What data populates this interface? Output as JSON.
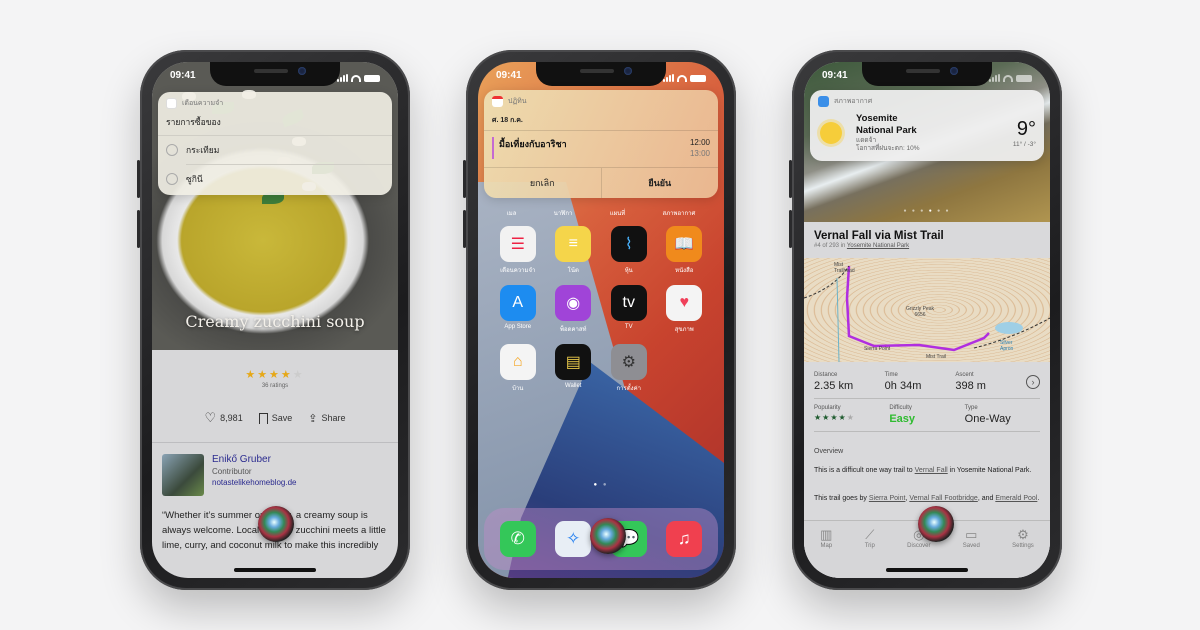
{
  "status_time": "09:41",
  "phone1": {
    "widget": {
      "app_name": "เตือนความจำ",
      "list_title": "รายการซื้อของ",
      "items": [
        "กระเทียม",
        "ซูกินี"
      ]
    },
    "recipe": {
      "title": "Creamy zucchini soup",
      "rating": 4.5,
      "rating_max": 5,
      "rating_count": "36 ratings",
      "likes": "8,981",
      "save_label": "Save",
      "share_label": "Share",
      "author_name": "Enikő Gruber",
      "author_role": "Contributor",
      "author_link": "notastelikehomeblog.de",
      "quote": "“Whether it’s summer or winter, a creamy soup is always welcome. Local favorite zucchini meets a little lime, curry, and coconut milk to make this incredibly"
    }
  },
  "phone2": {
    "widget": {
      "app_name": "ปฏิทิน",
      "date": "ศ. 18 ก.ค.",
      "event_title": "มื้อเที่ยงกับอาริชา",
      "start": "12:00",
      "end": "13:00",
      "cancel_label": "ยกเลิก",
      "confirm_label": "ยืนยัน",
      "event_color": "#c46ad2"
    },
    "top_row_labels": [
      "เมล",
      "นาฬิกา",
      "แผนที่",
      "สภาพอากาศ"
    ],
    "apps": [
      {
        "label": "เตือนความจำ",
        "icon": "reminders-icon",
        "bg": "#f2f2f2",
        "glyph": "☰",
        "fg": "#e24"
      },
      {
        "label": "โน้ต",
        "icon": "notes-icon",
        "bg": "#f5d54a",
        "glyph": "≡",
        "fg": "#fff"
      },
      {
        "label": "หุ้น",
        "icon": "stocks-icon",
        "bg": "#111",
        "glyph": "⌇",
        "fg": "#4ab4ff"
      },
      {
        "label": "หนังสือ",
        "icon": "books-icon",
        "bg": "#f08a1c",
        "glyph": "📖",
        "fg": "#fff"
      },
      {
        "label": "App Store",
        "icon": "app-store-icon",
        "bg": "#1d8cf0",
        "glyph": "A",
        "fg": "#fff"
      },
      {
        "label": "พ็อดคาสท์",
        "icon": "podcasts-icon",
        "bg": "#a044d8",
        "glyph": "◉",
        "fg": "#fff"
      },
      {
        "label": "TV",
        "icon": "tv-icon",
        "bg": "#111",
        "glyph": "tv",
        "fg": "#fff"
      },
      {
        "label": "สุขภาพ",
        "icon": "health-icon",
        "bg": "#f4f4f4",
        "glyph": "♥",
        "fg": "#f0405a"
      },
      {
        "label": "บ้าน",
        "icon": "home-icon",
        "bg": "#f4f4f4",
        "glyph": "⌂",
        "fg": "#f5a623"
      },
      {
        "label": "Wallet",
        "icon": "wallet-icon",
        "bg": "#111",
        "glyph": "▤",
        "fg": "#e8c84a"
      },
      {
        "label": "การตั้งค่า",
        "icon": "settings-icon",
        "bg": "#8e8e93",
        "glyph": "⚙",
        "fg": "#333"
      }
    ],
    "dock": [
      {
        "icon": "phone-icon",
        "bg": "#34c759",
        "glyph": "✆"
      },
      {
        "icon": "safari-icon",
        "bg": "#e8eef5",
        "glyph": "✧"
      },
      {
        "icon": "messages-icon",
        "bg": "#34c759",
        "glyph": "💬"
      },
      {
        "icon": "music-icon",
        "bg": "#f0404f",
        "glyph": "♫"
      }
    ]
  },
  "phone3": {
    "widget": {
      "app_name": "สภาพอากาศ",
      "location_line1": "Yosemite",
      "location_line2": "National Park",
      "condition": "แดดจ้า",
      "rain_chance": "โอกาสที่ฝนจะตก: 10%",
      "temp": "9°",
      "range": "11° / -3°"
    },
    "trail": {
      "title": "Vernal Fall via Mist Trail",
      "rank_text": "#4 of 293 in ",
      "rank_link": "Yosemite National Park",
      "map_labels": [
        "Mist Trailhead",
        "Grizzly Peak 6656",
        "Sierra Point",
        "Mist Trail",
        "Silver Apron"
      ],
      "stats": [
        {
          "key": "Distance",
          "value": "2.35 km"
        },
        {
          "key": "Time",
          "value": "0h 34m"
        },
        {
          "key": "Ascent",
          "value": "398 m"
        }
      ],
      "popularity_label": "Popularity",
      "popularity": 4,
      "popularity_max": 5,
      "difficulty_label": "Difficulty",
      "difficulty": "Easy",
      "type_label": "Type",
      "type": "One-Way",
      "overview_title": "Overview",
      "overview_p1_a": "This is a difficult one way trail to ",
      "overview_p1_link": "Vernal Fall",
      "overview_p1_b": " in Yosemite National Park.",
      "overview_p2_a": "This trail goes by ",
      "overview_p2_link1": "Sierra Point",
      "overview_p2_sep": ", ",
      "overview_p2_link2": "Vernal Fall Footbridge",
      "overview_p2_b": ", and ",
      "overview_p2_link3": "Emerald Pool",
      "overview_p2_end": "."
    },
    "tabs": [
      {
        "label": "Map",
        "icon": "map-icon",
        "glyph": "▥"
      },
      {
        "label": "Trip",
        "icon": "trip-icon",
        "glyph": "⟋"
      },
      {
        "label": "Discover",
        "icon": "discover-icon",
        "glyph": "◎"
      },
      {
        "label": "Saved",
        "icon": "saved-icon",
        "glyph": "▭"
      },
      {
        "label": "Settings",
        "icon": "settings-icon",
        "glyph": "⚙"
      }
    ]
  }
}
